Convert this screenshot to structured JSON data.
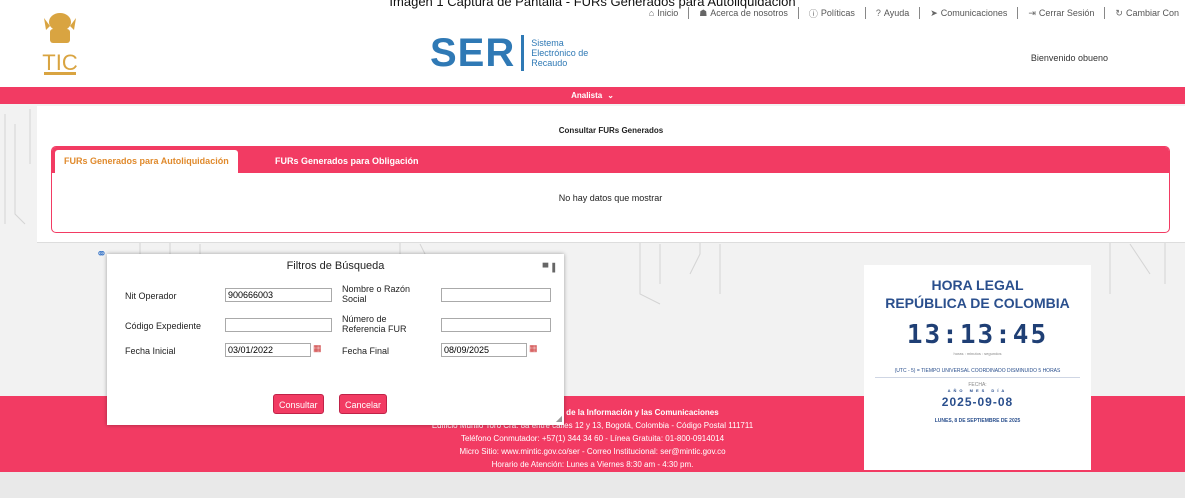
{
  "caption": "Imagen 1 Captura de Pantalla - FURs Generados para Autoliquidación",
  "topnav": [
    {
      "icon": "home-icon",
      "glyph": "⌂",
      "label": "Inicio"
    },
    {
      "icon": "users-icon",
      "glyph": "☗",
      "label": "Acerca de nosotros"
    },
    {
      "icon": "info-icon",
      "glyph": "ⓘ",
      "label": "Políticas"
    },
    {
      "icon": "help-icon",
      "glyph": "?",
      "label": "Ayuda"
    },
    {
      "icon": "send-icon",
      "glyph": "➤",
      "label": "Comunicaciones"
    },
    {
      "icon": "logout-icon",
      "glyph": "⇥",
      "label": "Cerrar Sesión"
    },
    {
      "icon": "refresh-icon",
      "glyph": "↻",
      "label": "Cambiar Con"
    }
  ],
  "logo": {
    "tic_text": "TIC"
  },
  "ser_logo": {
    "big": "SER",
    "line1": "Sistema",
    "line2": "Electrónico de",
    "line3": "Recaudo"
  },
  "welcome": "Bienvenido obueno",
  "role_menu": {
    "label": "Analista"
  },
  "fur": {
    "title": "Consultar FURs Generados",
    "tabs": [
      "FURs Generados para Autoliquidación",
      "FURs Generados para Obligación"
    ],
    "empty_message": "No hay datos que mostrar"
  },
  "filters": {
    "title": "Filtros de Búsqueda",
    "nit_label": "Nit Operador",
    "nit_value": "900666003",
    "nombre_label": "Nombre o Razón Social",
    "nombre_value": "",
    "codigo_label": "Código Expediente",
    "codigo_value": "",
    "referencia_label": "Número de Referencia FUR",
    "referencia_value": "",
    "fecha_inicial_label": "Fecha Inicial",
    "fecha_inicial_value": "03/01/2022",
    "fecha_final_label": "Fecha Final",
    "fecha_final_value": "08/09/2025",
    "consultar": "Consultar",
    "cancelar": "Cancelar"
  },
  "footer": {
    "line1": "Ministerio de Tecnologías de la Información y las Comunicaciones",
    "line2": "Edificio Murillo Toro Cra. 8a entre calles 12 y 13, Bogotá, Colombia - Código Postal 111711",
    "line3": "Teléfono Conmutador: +57(1) 344 34 60 - Línea Gratuita: 01-800-0914014",
    "line4": "Micro Sitio: www.mintic.gov.co/ser - Correo Institucional: ser@mintic.gov.co",
    "line5": "Horario de Atención: Lunes a Viernes 8:30 am - 4:30 pm."
  },
  "clock": {
    "title1": "HORA LEGAL",
    "title2": "REPÚBLICA DE COLOMBIA",
    "time": "13:13:45",
    "units": "horas : minutos : segundos",
    "utc": "(UTC - 5) = TIEMPO UNIVERSAL COORDINADO DISMINUIDO 5 HORAS",
    "fecha_label": "FECHA:",
    "ymd": "AÑO MES DÍA",
    "date": "2025-09-08",
    "long_date": "LUNES, 8 DE SEPTIEMBRE DE 2025"
  },
  "colors": {
    "accent": "#f23b63",
    "brand_blue": "#2f79b5",
    "tab_active_text": "#e08a2c"
  }
}
